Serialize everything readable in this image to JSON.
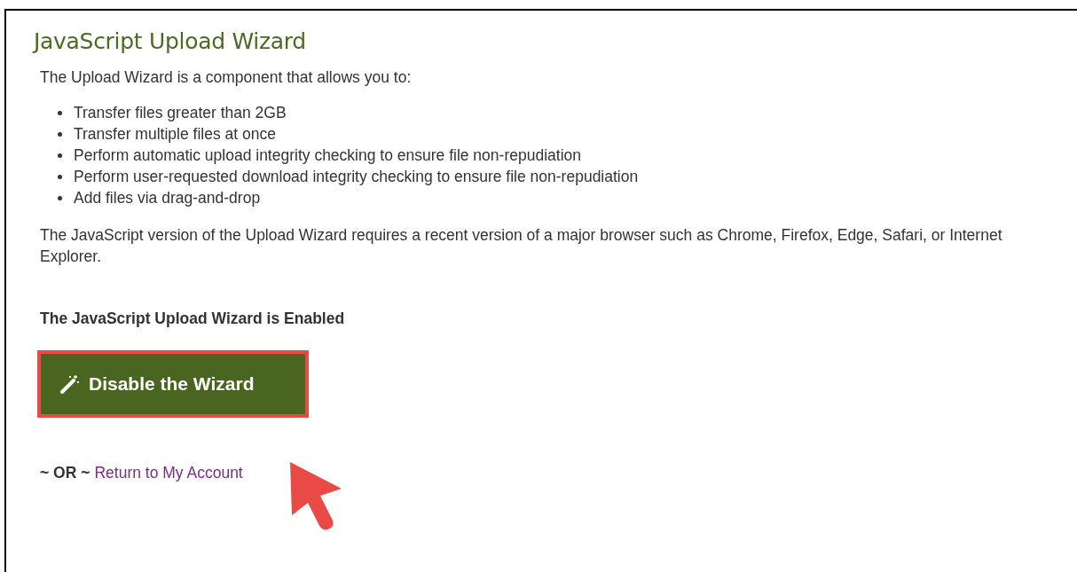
{
  "title": "JavaScript Upload Wizard",
  "intro": "The Upload Wizard is a component that allows you to:",
  "features": [
    "Transfer files greater than 2GB",
    "Transfer multiple files at once",
    "Perform automatic upload integrity checking to ensure file non-repudiation",
    "Perform user-requested download integrity checking to ensure file non-repudiation",
    "Add files via drag-and-drop"
  ],
  "requirements": "The JavaScript version of the Upload Wizard requires a recent version of a major browser such as Chrome, Firefox, Edge, Safari, or Internet Explorer.",
  "status": "The JavaScript Upload Wizard is Enabled",
  "button": {
    "label": "Disable the Wizard",
    "highlighted": true
  },
  "alternative": {
    "prefix": "~ OR ~",
    "link": "Return to My Account"
  }
}
